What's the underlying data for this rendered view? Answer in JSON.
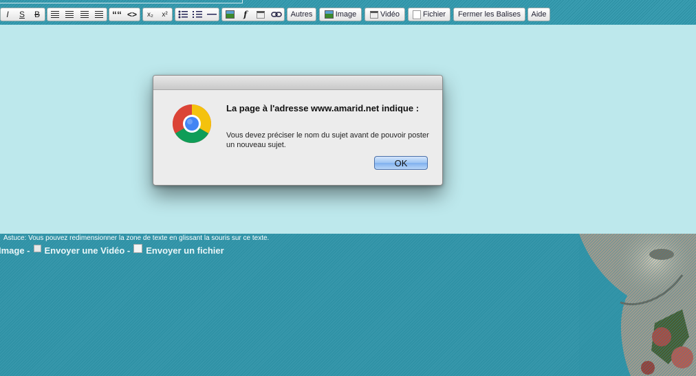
{
  "toolbar": {
    "format_buttons": [
      "I",
      "S",
      "B"
    ],
    "quote_symbol": "““",
    "code_symbol": "<>",
    "subscript_label": "x₂",
    "superscript_label": "x²",
    "flash_symbol": "f",
    "autres_label": "Autres",
    "image_label": "Image",
    "video_label": "Vidéo",
    "fichier_label": "Fichier",
    "fermer_label": "Fermer les Balises",
    "aide_label": "Aide"
  },
  "footer": {
    "tip": "Astuce: Vous pouvez redimensionner la zone de texte en glissant la souris sur ce texte.",
    "link_image": "Image -",
    "link_video": "Envoyer une Vidéo -",
    "link_file": "Envoyer un fichier"
  },
  "dialog": {
    "title": "La page à l'adresse www.amarid.net indique :",
    "message": "Vous devez préciser le nom du sujet avant de pouvoir poster un nouveau sujet.",
    "ok_label": "OK"
  }
}
